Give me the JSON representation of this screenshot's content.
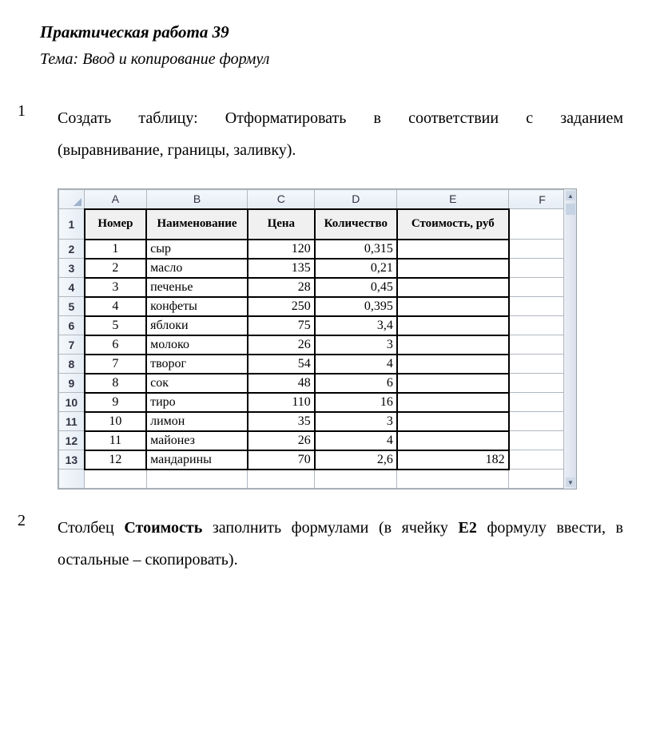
{
  "title": "Практическая работа 39",
  "subtitle": "Тема: Ввод и копирование формул",
  "task1": {
    "line1_w1": "Создать",
    "line1_w2": "таблицу:",
    "line1_w3": "Отформатировать",
    "line1_w4": "в",
    "line1_w5": "соответствии",
    "line1_w6": "с",
    "line1_w7": "заданием",
    "line2": "(выравнивание, границы, заливку)."
  },
  "task2": {
    "pre": "Столбец ",
    "b1": "Стоимость",
    "mid1": " заполнить формулами (в ячейку ",
    "b2": "Е2",
    "mid2": " формулу ввести, в",
    "line2": "остальные – скопировать)."
  },
  "sheet": {
    "cols": [
      "A",
      "B",
      "C",
      "D",
      "E",
      "F"
    ],
    "row_numbers": [
      "1",
      "2",
      "3",
      "4",
      "5",
      "6",
      "7",
      "8",
      "9",
      "10",
      "11",
      "12",
      "13"
    ],
    "headers": {
      "A": "Номер",
      "B": "Наименование",
      "C": "Цена",
      "D": "Количество",
      "E": "Стоимость, руб"
    },
    "rows": [
      {
        "n": "1",
        "name": "сыр",
        "price": "120",
        "qty": "0,315",
        "cost": ""
      },
      {
        "n": "2",
        "name": "масло",
        "price": "135",
        "qty": "0,21",
        "cost": ""
      },
      {
        "n": "3",
        "name": "печенье",
        "price": "28",
        "qty": "0,45",
        "cost": ""
      },
      {
        "n": "4",
        "name": "конфеты",
        "price": "250",
        "qty": "0,395",
        "cost": ""
      },
      {
        "n": "5",
        "name": "яблоки",
        "price": "75",
        "qty": "3,4",
        "cost": ""
      },
      {
        "n": "6",
        "name": "молоко",
        "price": "26",
        "qty": "3",
        "cost": ""
      },
      {
        "n": "7",
        "name": "творог",
        "price": "54",
        "qty": "4",
        "cost": ""
      },
      {
        "n": "8",
        "name": "сок",
        "price": "48",
        "qty": "6",
        "cost": ""
      },
      {
        "n": "9",
        "name": "тиро",
        "price": "110",
        "qty": "16",
        "cost": ""
      },
      {
        "n": "10",
        "name": "лимон",
        "price": "35",
        "qty": "3",
        "cost": ""
      },
      {
        "n": "11",
        "name": "майонез",
        "price": "26",
        "qty": "4",
        "cost": ""
      },
      {
        "n": "12",
        "name": "мандарины",
        "price": "70",
        "qty": "2,6",
        "cost": "182"
      }
    ]
  }
}
